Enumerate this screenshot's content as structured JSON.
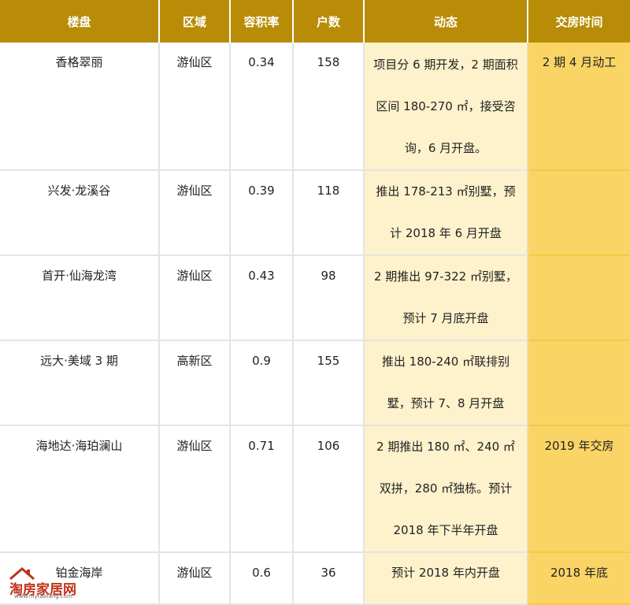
{
  "table": {
    "headers": [
      "楼盘",
      "区域",
      "容积率",
      "户数",
      "动态",
      "交房时间"
    ],
    "rows": [
      {
        "name": "香格翠丽",
        "district": "游仙区",
        "far": "0.34",
        "units": "158",
        "news": "项目分 6 期开发，2 期面积区间 180-270 ㎡，接受咨询，6 月开盘。",
        "delivery": "2 期 4 月动工"
      },
      {
        "name": "兴发·龙溪谷",
        "district": "游仙区",
        "far": "0.39",
        "units": "118",
        "news": "推出 178-213 ㎡别墅，预计 2018 年 6 月开盘",
        "delivery": ""
      },
      {
        "name": "首开·仙海龙湾",
        "district": "游仙区",
        "far": "0.43",
        "units": "98",
        "news": "2 期推出 97-322 ㎡别墅，预计 7 月底开盘",
        "delivery": ""
      },
      {
        "name": "远大·美域 3 期",
        "district": "高新区",
        "far": "0.9",
        "units": "155",
        "news": "推出 180-240 ㎡联排别墅，预计 7、8 月开盘",
        "delivery": ""
      },
      {
        "name": "海地达·海珀澜山",
        "district": "游仙区",
        "far": "0.71",
        "units": "106",
        "news": "2 期推出 180 ㎡、240 ㎡双拼，280 ㎡独栋。预计 2018 年下半年开盘",
        "delivery": "2019 年交房"
      },
      {
        "name": "铂金海岸",
        "district": "游仙区",
        "far": "0.6",
        "units": "36",
        "news": "预计 2018 年内开盘",
        "delivery": "2018 年底"
      }
    ]
  },
  "watermark": {
    "brand": "淘房家居网",
    "url": "www.mytaofang.com",
    "brand_color": "#c0321b"
  },
  "colors": {
    "header_bg": "#b88c06",
    "news_bg": "#fdf2cc",
    "delivery_bg": "#fbd466"
  }
}
